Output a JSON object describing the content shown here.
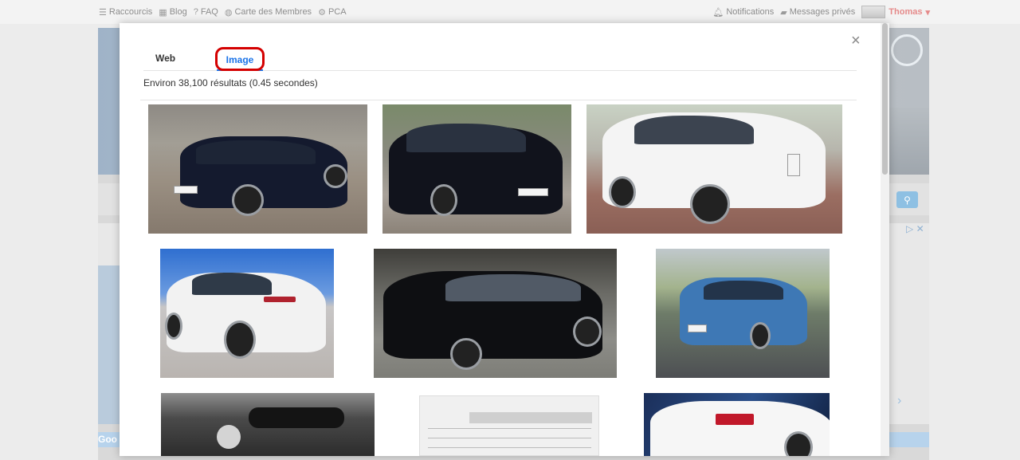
{
  "topnav": {
    "left": [
      {
        "label": "Raccourcis",
        "icon": "menu-icon"
      },
      {
        "label": "Blog",
        "icon": "grid-icon"
      },
      {
        "label": "FAQ",
        "icon": "help-icon"
      },
      {
        "label": "Carte des Membres",
        "icon": "globe-icon"
      },
      {
        "label": "PCA",
        "icon": "gears-icon"
      }
    ],
    "right": [
      {
        "label": "Notifications",
        "icon": "bell-icon"
      },
      {
        "label": "Messages privés",
        "icon": "message-icon"
      }
    ],
    "user": "Thomas"
  },
  "background": {
    "bottom_bar_text": "Goo"
  },
  "modal": {
    "close_label": "×",
    "tabs": [
      {
        "label": "Web",
        "active": false
      },
      {
        "label": "Image",
        "active": true
      }
    ],
    "results_text": "Environ 38,100 résultats (0.45 secondes)",
    "images": [
      {
        "name": "black-golf-rear-driveway"
      },
      {
        "name": "black-golf-front-parked"
      },
      {
        "name": "white-golf-front-brick"
      },
      {
        "name": "white-golf-rear-sunny"
      },
      {
        "name": "black-golf-gti-front"
      },
      {
        "name": "blue-golf-parking"
      },
      {
        "name": "engine-bay"
      },
      {
        "name": "spec-table-document"
      },
      {
        "name": "white-golf-taillight-night"
      }
    ]
  },
  "colors": {
    "accent": "#1a73e8",
    "highlight_border": "#d40000",
    "user": "#e58a8a"
  }
}
